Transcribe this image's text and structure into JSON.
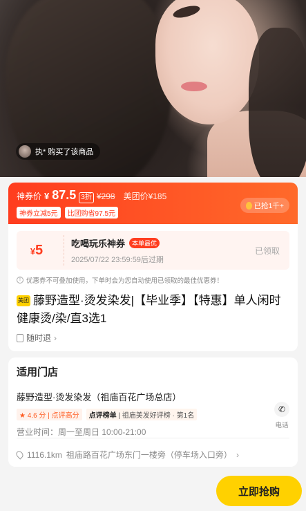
{
  "hero": {
    "buyer_text": "执* 购买了该商品"
  },
  "price": {
    "label": "神券价",
    "currency": "¥",
    "value": "87.5",
    "discount": "3折",
    "original": "¥298",
    "meituan_price": "美团价¥185",
    "tags": [
      "神券立减5元",
      "比团购省97.5元"
    ],
    "sold": "已抢1千+"
  },
  "coupon": {
    "currency": "¥",
    "amount": "5",
    "title": "吃喝玩乐神券",
    "badge": "本单最优",
    "expiry": "2025/07/22 23:59:59后过期",
    "status": "已领取"
  },
  "tip": "优惠券不可叠加使用，下单时会为您自动使用已领取的最佳优惠券！",
  "product": {
    "tag": "美团",
    "title": "藤野造型·烫发染发|【毕业季】【特惠】单人闲时健康烫/染/直3选1",
    "refund": "随时退"
  },
  "store": {
    "heading": "适用门店",
    "name": "藤野造型·烫发染发（祖庙百花广场总店）",
    "rating": "4.6 分",
    "rating_note": "点评高分",
    "rank_label": "点评榜单",
    "rank_text": "祖庙美发好评榜 · 第1名",
    "hours": "营业时间：周一至周日 10:00-21:00",
    "phone_label": "电话",
    "distance": "1116.1km",
    "address": "祖庙路百花广场东门一楼旁（停车场入口旁）"
  },
  "actions": {
    "buy_label": "立即抢购"
  }
}
